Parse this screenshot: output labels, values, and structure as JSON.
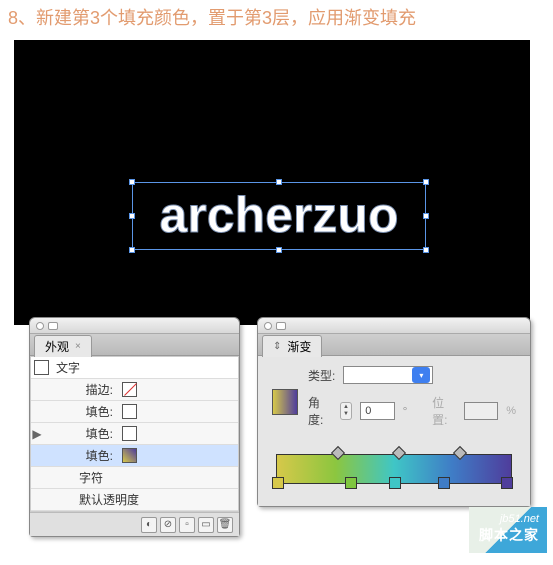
{
  "instruction": "8、新建第3个填充颜色，置于第3层，应用渐变填充",
  "artwork_text": "archerzuo",
  "appearance": {
    "tab_label": "外观",
    "rows": {
      "text": "文字",
      "stroke": "描边:",
      "fill1": "填色:",
      "fill2": "填色:",
      "fill3": "填色:",
      "char": "字符",
      "default": "默认透明度"
    }
  },
  "gradient": {
    "tab_label": "渐变",
    "type_label": "类型:",
    "angle_label": "角度:",
    "angle_value": "0",
    "position_label": "位置:",
    "percent": "%"
  },
  "watermark": {
    "url": "jb51.net",
    "site_name": "脚本之家"
  }
}
